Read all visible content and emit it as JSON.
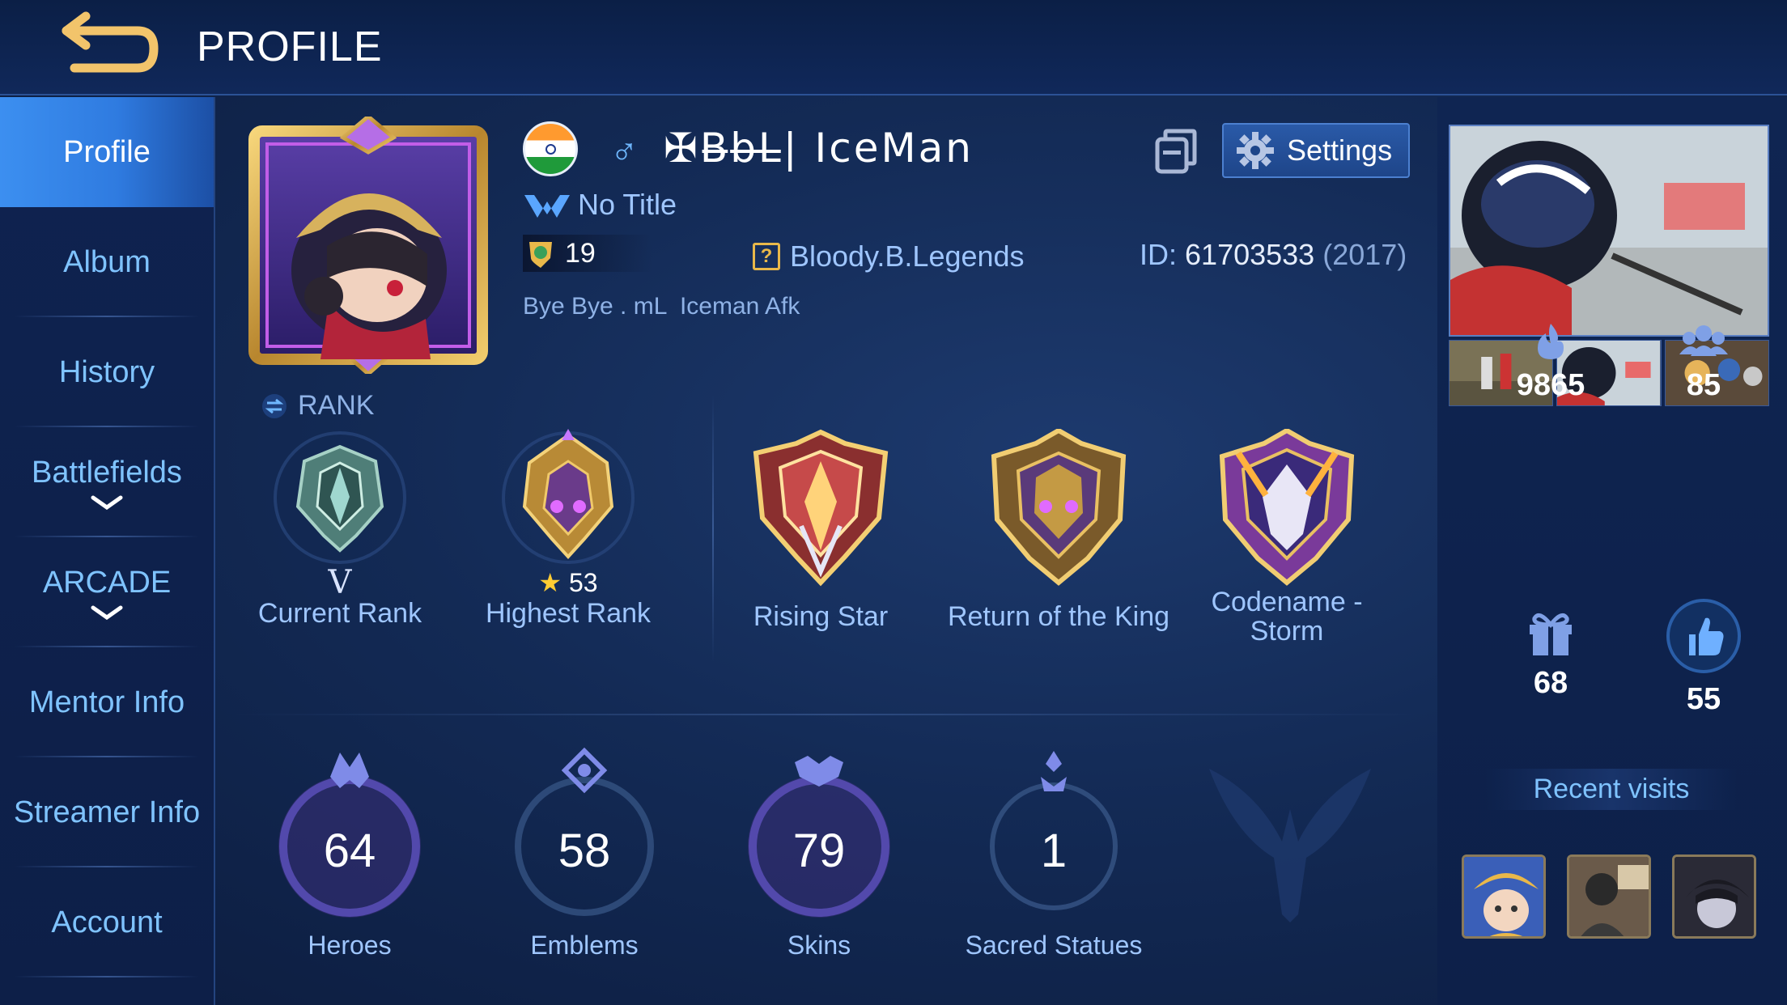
{
  "header": {
    "title": "PROFILE"
  },
  "sidebar": {
    "items": [
      {
        "label": "Profile"
      },
      {
        "label": "Album"
      },
      {
        "label": "History"
      },
      {
        "label": "Battlefields"
      },
      {
        "label": "ARCADE"
      },
      {
        "label": "Mentor Info"
      },
      {
        "label": "Streamer Info"
      },
      {
        "label": "Account"
      }
    ]
  },
  "player": {
    "gender_symbol": "♂",
    "name": "✠B̶b̶L̶| IceMan",
    "title": "No Title",
    "level": "19",
    "squad": "Bloody.B.Legends",
    "squad_icon": "?",
    "id_label": "ID:",
    "id_number": "61703533",
    "id_year": "(2017)",
    "signature": "Bye Bye . mL  Iceman Afk"
  },
  "settings": {
    "label": "Settings"
  },
  "rank_section": {
    "label": "RANK"
  },
  "badges": [
    {
      "caption": "Current Rank",
      "detail": "V"
    },
    {
      "caption": "Highest Rank",
      "detail_star": "★",
      "detail": "53"
    },
    {
      "caption": "Rising Star"
    },
    {
      "caption": "Return of the King"
    },
    {
      "caption": "Codename - Storm"
    }
  ],
  "stats": [
    {
      "value": "64",
      "caption": "Heroes"
    },
    {
      "value": "58",
      "caption": "Emblems"
    },
    {
      "value": "79",
      "caption": "Skins"
    },
    {
      "value": "1",
      "caption": "Sacred Statues"
    }
  ],
  "right": {
    "popularity": "9865",
    "followers": "85",
    "gifts": "68",
    "likes": "55",
    "recent_visits_label": "Recent visits"
  },
  "colors": {
    "accent": "#3c8ff0",
    "text_blue": "#9fc6ff",
    "gold": "#e9b84a",
    "background": "#132a55"
  },
  "icons": [
    "back-arrow-icon",
    "flag-india-icon",
    "male-icon",
    "copy-icon",
    "gear-icon",
    "title-icon",
    "level-shield-icon",
    "squad-icon",
    "rank-icon",
    "fire-icon",
    "friends-icon",
    "gift-icon",
    "thumbs-up-icon",
    "chevron-down-icon"
  ]
}
